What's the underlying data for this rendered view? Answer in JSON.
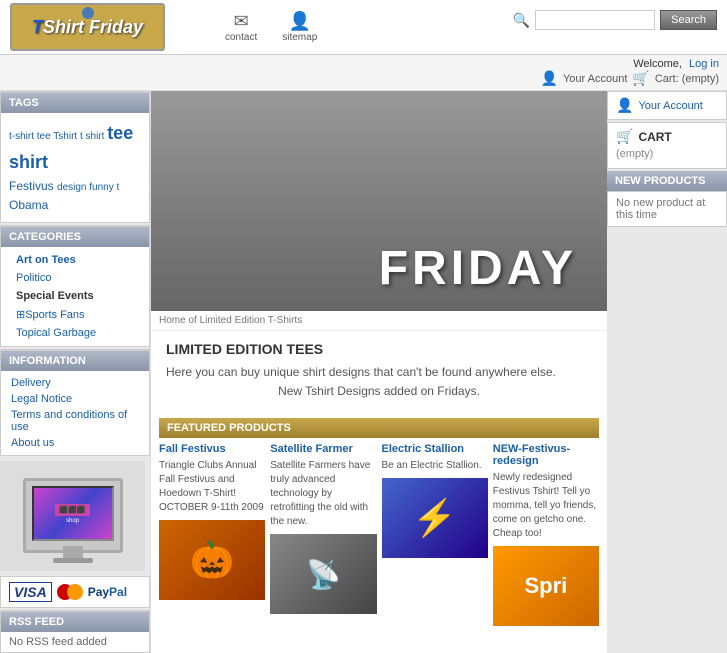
{
  "header": {
    "logo_text": "TShirt Friday",
    "logo_t": "T",
    "logo_shirt": "Shirt",
    "logo_friday": "Friday",
    "nav": [
      {
        "id": "contact",
        "label": "contact",
        "icon": "✉"
      },
      {
        "id": "sitemap",
        "label": "sitemap",
        "icon": "👤"
      }
    ],
    "search_placeholder": "",
    "search_button": "Search",
    "welcome_text": "Welcome,",
    "login_label": "Log in"
  },
  "right_sidebar": {
    "account_icon": "👤",
    "account_label": "Your Account",
    "cart_label": "CART",
    "cart_icon": "🛒",
    "cart_status": "(empty)",
    "new_products_header": "NEW PRODUCTS",
    "new_products_text": "No new product at this time"
  },
  "sidebar": {
    "tags_header": "TAGS",
    "tags": [
      {
        "text": "t-shirt",
        "size": "small"
      },
      {
        "text": "tee",
        "size": "small"
      },
      {
        "text": "Tshirt",
        "size": "small"
      },
      {
        "text": "t shirt",
        "size": "small"
      },
      {
        "text": "tee shirt",
        "size": "large"
      },
      {
        "text": "Festivus",
        "size": "medium"
      },
      {
        "text": "design",
        "size": "small"
      },
      {
        "text": "funny",
        "size": "small"
      },
      {
        "text": "t",
        "size": "small"
      },
      {
        "text": "Obama",
        "size": "medium"
      }
    ],
    "categories_header": "CATEGORIES",
    "categories": [
      {
        "label": "Art on Tees",
        "bold": true
      },
      {
        "label": "Politico",
        "bold": false
      },
      {
        "label": "Special Events",
        "bold": true
      },
      {
        "label": "⊞Sports Fans",
        "bold": false
      },
      {
        "label": "Topical Garbage",
        "bold": false
      }
    ],
    "info_header": "INFORMATION",
    "info_items": [
      "Delivery",
      "Legal Notice",
      "Terms and conditions of use",
      "About us"
    ],
    "rss_header": "RSS FEED",
    "rss_text": "No RSS feed added"
  },
  "main": {
    "home_text": "Home of Limited Edition T-Shirts",
    "limited_title": "LIMITED EDITION TEES",
    "limited_desc": "Here you can buy unique shirt designs that can't be found anywhere else.",
    "new_designs_text": "New Tshirt Designs added on Fridays.",
    "featured_header": "FEATURED PRODUCTS",
    "products": [
      {
        "name": "Fall Festivus",
        "desc": "Triangle Clubs Annual Fall Festivus and Hoedown T-Shirt! OCTOBER 9-11th 2009",
        "img_class": "product-img-fall",
        "img_text": "🎃"
      },
      {
        "name": "Satellite Farmer",
        "desc": "Satellite Farmers have truly advanced technology by retrofitting the old with the new.",
        "img_class": "product-img-satellite",
        "img_text": "📡"
      },
      {
        "name": "Electric Stallion",
        "desc": "Be an Electric Stallion.",
        "img_class": "product-img-electric",
        "img_text": "⚡"
      },
      {
        "name": "NEW-Festivus-redesign",
        "desc": "Newly redesigned Festivus Tshirt! Tell yo momma, tell yo friends, come on getcho one. Cheap too!",
        "img_class": "product-img-festivus",
        "img_text": "Spri"
      }
    ]
  }
}
